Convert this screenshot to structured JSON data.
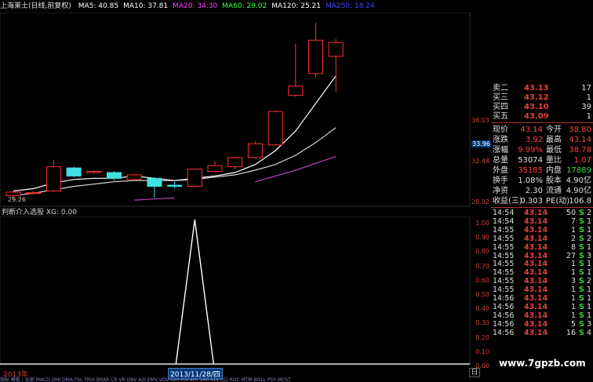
{
  "window": {
    "stock_title": "上海莱士(日线,前复权)",
    "ma_items": [
      {
        "label": "MA5: 40.85",
        "color": "#ffffff"
      },
      {
        "label": "MA10: 37.81",
        "color": "#ffffff"
      },
      {
        "label": "MA20: 34.30",
        "color": "#ff40ff"
      },
      {
        "label": "MA60: 29.02",
        "color": "#40ff40"
      },
      {
        "label": "MA120: 25.21",
        "color": "#ffffff"
      },
      {
        "label": "MA250: 18.24",
        "color": "#4040ff"
      }
    ]
  },
  "price_axis": {
    "labels": [
      "36.03",
      "33.96",
      "32.48",
      "28.92"
    ],
    "current_label": "33.96"
  },
  "min_price_label": "29.26",
  "indicator": {
    "title": "判断介入选股 XG: 0.00",
    "axis_labels": [
      "1.00",
      "0.90",
      "0.80",
      "0.70",
      "0.60",
      "0.50",
      "0.40",
      "0.30",
      "0.20",
      "0.10",
      "0.00"
    ],
    "peak_value": 1.0
  },
  "date_axis": {
    "year_label": "2013年",
    "cursor_date": "2013/11/28/四"
  },
  "period_button": "日",
  "bottom_tabs": "指标 模板 | 全部 MACD DMI DMA FSL TRIX BRAR CR VR OBV ASI EMV VOL-TDX RSI WR SAR KDJ CCI ROC MTM BOLL PSY MCST",
  "quote": {
    "sell_levels": [
      {
        "name": "卖二",
        "price": "43.13",
        "vol": "17"
      },
      {
        "name": "买三",
        "price": "43.12",
        "vol": "1"
      },
      {
        "name": "买四",
        "price": "43.10",
        "vol": "39"
      },
      {
        "name": "买五",
        "price": "43.09",
        "vol": "1"
      }
    ],
    "stats": [
      {
        "l1": "现价",
        "v1": "43.14",
        "c1": "red",
        "l2": "今开",
        "v2": "38.80",
        "c2": "red"
      },
      {
        "l1": "涨跌",
        "v1": "3.92",
        "c1": "red",
        "l2": "最高",
        "v2": "43.14",
        "c2": "red"
      },
      {
        "l1": "涨幅",
        "v1": "9.99%",
        "c1": "red",
        "l2": "最低",
        "v2": "38.78",
        "c2": "red"
      },
      {
        "l1": "总量",
        "v1": "53074",
        "c1": "white",
        "l2": "量比",
        "v2": "1.07",
        "c2": "red"
      },
      {
        "l1": "外盘",
        "v1": "35185",
        "c1": "red",
        "l2": "内盘",
        "v2": "17889",
        "c2": "green"
      },
      {
        "l1": "换手",
        "v1": "1.08%",
        "c1": "white",
        "l2": "股本",
        "v2": "4.90亿",
        "c2": "white"
      },
      {
        "l1": "净资",
        "v1": "2.30",
        "c1": "white",
        "l2": "流通",
        "v2": "4.90亿",
        "c2": "white"
      },
      {
        "l1": "收益(三)",
        "v1": "0.303",
        "c1": "white",
        "l2": "PE(动)",
        "v2": "106.8",
        "c2": "white"
      }
    ],
    "ticks": [
      {
        "time": "14:54",
        "price": "43.14",
        "vol": "50",
        "bs": "S",
        "cnt": "2"
      },
      {
        "time": "14:54",
        "price": "43.14",
        "vol": "7",
        "bs": "S",
        "cnt": "1"
      },
      {
        "time": "14:55",
        "price": "43.14",
        "vol": "1",
        "bs": "S",
        "cnt": "1"
      },
      {
        "time": "14:55",
        "price": "43.14",
        "vol": "2",
        "bs": "S",
        "cnt": "2"
      },
      {
        "time": "14:55",
        "price": "43.14",
        "vol": "8",
        "bs": "S",
        "cnt": "1"
      },
      {
        "time": "14:55",
        "price": "43.14",
        "vol": "27",
        "bs": "S",
        "cnt": "3"
      },
      {
        "time": "14:55",
        "price": "43.14",
        "vol": "1",
        "bs": "S",
        "cnt": "1"
      },
      {
        "time": "14:55",
        "price": "43.14",
        "vol": "1",
        "bs": "S",
        "cnt": "1"
      },
      {
        "time": "14:55",
        "price": "43.14",
        "vol": "3",
        "bs": "S",
        "cnt": "2"
      },
      {
        "time": "14:55",
        "price": "43.14",
        "vol": "1",
        "bs": "S",
        "cnt": "1"
      },
      {
        "time": "14:56",
        "price": "43.14",
        "vol": "1",
        "bs": "S",
        "cnt": "1"
      },
      {
        "time": "14:56",
        "price": "43.14",
        "vol": "1",
        "bs": "S",
        "cnt": "1"
      },
      {
        "time": "14:56",
        "price": "43.14",
        "vol": "1",
        "bs": "S",
        "cnt": "1"
      },
      {
        "time": "14:56",
        "price": "43.14",
        "vol": "5",
        "bs": "S",
        "cnt": "3"
      },
      {
        "time": "14:56",
        "price": "43.14",
        "vol": "16",
        "bs": "S",
        "cnt": "4"
      }
    ]
  },
  "watermark": "www.7gpzb.com",
  "chart_data": {
    "type": "candlestick",
    "price_range": [
      28.6,
      45.5
    ],
    "candles": [
      {
        "o": 29.6,
        "c": 29.9,
        "h": 30.0,
        "l": 29.26,
        "up": true
      },
      {
        "o": 29.8,
        "c": 29.85,
        "h": 30.0,
        "l": 29.7,
        "up": true
      },
      {
        "o": 30.0,
        "c": 32.1,
        "h": 32.7,
        "l": 29.9,
        "up": true
      },
      {
        "o": 32.0,
        "c": 31.3,
        "h": 32.1,
        "l": 31.2,
        "up": false
      },
      {
        "o": 31.6,
        "c": 31.7,
        "h": 31.8,
        "l": 31.5,
        "up": true
      },
      {
        "o": 31.6,
        "c": 31.1,
        "h": 31.7,
        "l": 30.9,
        "up": false
      },
      {
        "o": 31.0,
        "c": 31.4,
        "h": 31.5,
        "l": 30.9,
        "up": true
      },
      {
        "o": 31.1,
        "c": 30.4,
        "h": 31.2,
        "l": 29.4,
        "up": false
      },
      {
        "o": 30.4,
        "c": 30.5,
        "h": 30.8,
        "l": 30.2,
        "up": false
      },
      {
        "o": 30.4,
        "c": 31.9,
        "h": 31.9,
        "l": 30.3,
        "up": true
      },
      {
        "o": 31.7,
        "c": 32.2,
        "h": 32.6,
        "l": 31.6,
        "up": true
      },
      {
        "o": 32.1,
        "c": 32.9,
        "h": 33.0,
        "l": 31.9,
        "up": true
      },
      {
        "o": 32.9,
        "c": 34.1,
        "h": 34.3,
        "l": 32.8,
        "up": true
      },
      {
        "o": 34.0,
        "c": 36.9,
        "h": 37.0,
        "l": 33.9,
        "up": true
      },
      {
        "o": 38.3,
        "c": 39.1,
        "h": 42.8,
        "l": 38.2,
        "up": true
      },
      {
        "o": 40.2,
        "c": 43.1,
        "h": 44.6,
        "l": 39.9,
        "up": true
      },
      {
        "o": 41.7,
        "c": 42.9,
        "h": 43.2,
        "l": 38.6,
        "up": true
      }
    ],
    "ma5": [
      30.0,
      30.2,
      30.7,
      31.0,
      31.1,
      31.1,
      31.3,
      31.1,
      30.9,
      31.1,
      31.3,
      31.6,
      32.3,
      33.5,
      35.2,
      37.6,
      40.0
    ],
    "ma10": [
      29.6,
      29.8,
      30.1,
      30.4,
      30.6,
      30.8,
      30.9,
      30.9,
      30.9,
      31.0,
      31.2,
      31.4,
      31.8,
      32.3,
      33.1,
      34.2,
      35.5
    ],
    "ma20": [
      null,
      null,
      null,
      null,
      null,
      null,
      29.2,
      29.3,
      29.4,
      null,
      null,
      null,
      30.8,
      31.3,
      31.8,
      32.4,
      33.0
    ]
  }
}
